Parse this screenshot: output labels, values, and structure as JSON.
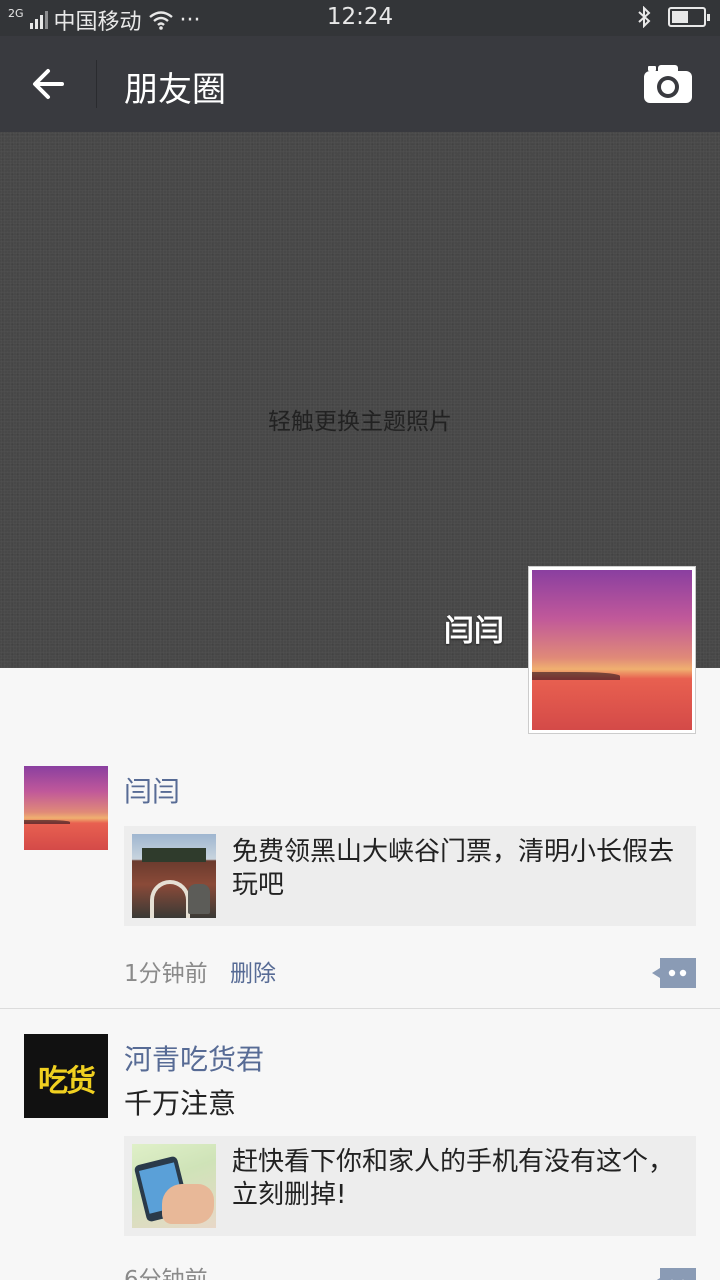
{
  "status_bar": {
    "network": "2G",
    "carrier": "中国移动",
    "more": "···",
    "time": "12:24",
    "icons": [
      "signal-icon",
      "wifi-icon",
      "bluetooth-icon",
      "battery-icon"
    ],
    "battery_level": 0.45
  },
  "nav": {
    "title": "朋友圈",
    "back_icon": "back-arrow-icon",
    "camera_icon": "camera-icon"
  },
  "cover": {
    "hint": "轻触更换主题照片",
    "profile_name": "闫闫"
  },
  "posts": [
    {
      "author": "闫闫",
      "text": "",
      "link_title": "免费领黑山大峡谷门票，清明小长假去玩吧",
      "time": "1分钟前",
      "delete": "删除"
    },
    {
      "author": "河青吃货君",
      "avatar_logo_text": "吃货",
      "text": "千万注意",
      "link_title": "赶快看下你和家人的手机有没有这个，立刻删掉!",
      "time": "6分钟前"
    }
  ],
  "colors": {
    "nav_bg": "#393a3f",
    "link_blue": "#576b95",
    "feed_bg": "#f7f7f7"
  }
}
